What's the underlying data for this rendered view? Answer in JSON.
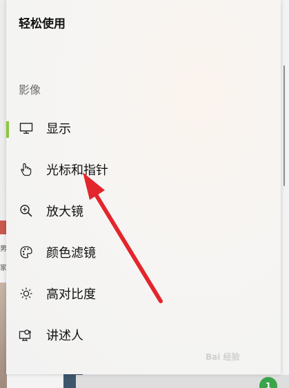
{
  "panel": {
    "title": "轻松使用",
    "section_label": "影像"
  },
  "nav": {
    "items": [
      {
        "label": "显示",
        "icon": "monitor-icon",
        "selected": true
      },
      {
        "label": "光标和指针",
        "icon": "pointer-hand-icon",
        "selected": false
      },
      {
        "label": "放大镜",
        "icon": "magnifier-icon",
        "selected": false
      },
      {
        "label": "颜色滤镜",
        "icon": "palette-icon",
        "selected": false
      },
      {
        "label": "高对比度",
        "icon": "brightness-icon",
        "selected": false
      },
      {
        "label": "讲述人",
        "icon": "narrator-icon",
        "selected": false
      }
    ]
  },
  "background": {
    "left_text_1": "男",
    "left_text_2": "家",
    "badge_count": "1"
  },
  "colors": {
    "selection_indicator": "#8cc63f",
    "annotation_arrow": "#e3262c"
  },
  "watermark": "Bai 经验"
}
